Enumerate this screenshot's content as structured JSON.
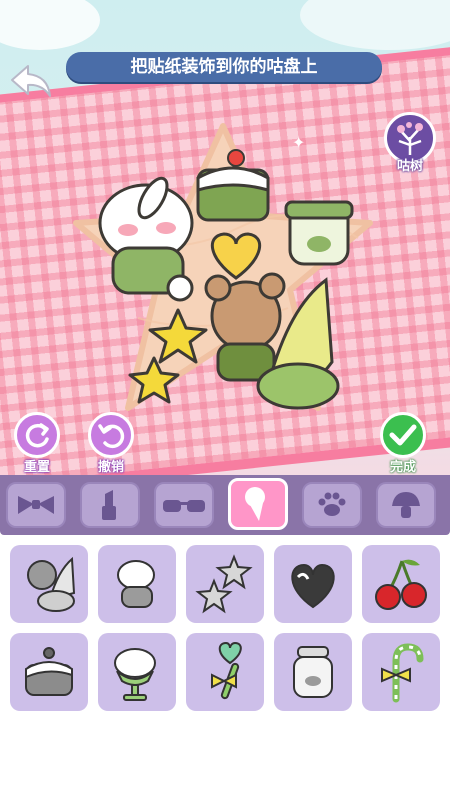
{
  "header": {
    "banner_text": "把贴纸装饰到你的咕盘上",
    "back_icon": "back-arrow-icon"
  },
  "profile": {
    "label": "咕树",
    "icon": "tree-avatar-icon"
  },
  "actions": {
    "reset_label": "重置",
    "undo_label": "撤销",
    "done_label": "完成"
  },
  "categories": [
    {
      "icon": "bow-icon",
      "active": false
    },
    {
      "icon": "lipstick-icon",
      "active": false
    },
    {
      "icon": "sunglasses-icon",
      "active": false
    },
    {
      "icon": "ice-cream-icon",
      "active": true
    },
    {
      "icon": "paw-icon",
      "active": false
    },
    {
      "icon": "mushroom-icon",
      "active": false
    }
  ],
  "stickers": [
    {
      "name": "bear-icecream-sticker"
    },
    {
      "name": "bunny-sticker"
    },
    {
      "name": "stars-sticker"
    },
    {
      "name": "heart-chocolate-sticker"
    },
    {
      "name": "cherry-sticker"
    },
    {
      "name": "cake-sticker"
    },
    {
      "name": "parfait-sticker"
    },
    {
      "name": "heart-wand-sticker"
    },
    {
      "name": "pudding-jar-sticker"
    },
    {
      "name": "candy-cane-sticker"
    }
  ],
  "colors": {
    "banner_bg": "#4a6da8",
    "action_purple": "#c77be0",
    "done_green": "#3bbf4f",
    "tabbar_bg": "#8a74a8",
    "tab_active": "#ff96c8",
    "cell_bg": "#cdbfe9",
    "sticker_green": "#8fb566"
  }
}
